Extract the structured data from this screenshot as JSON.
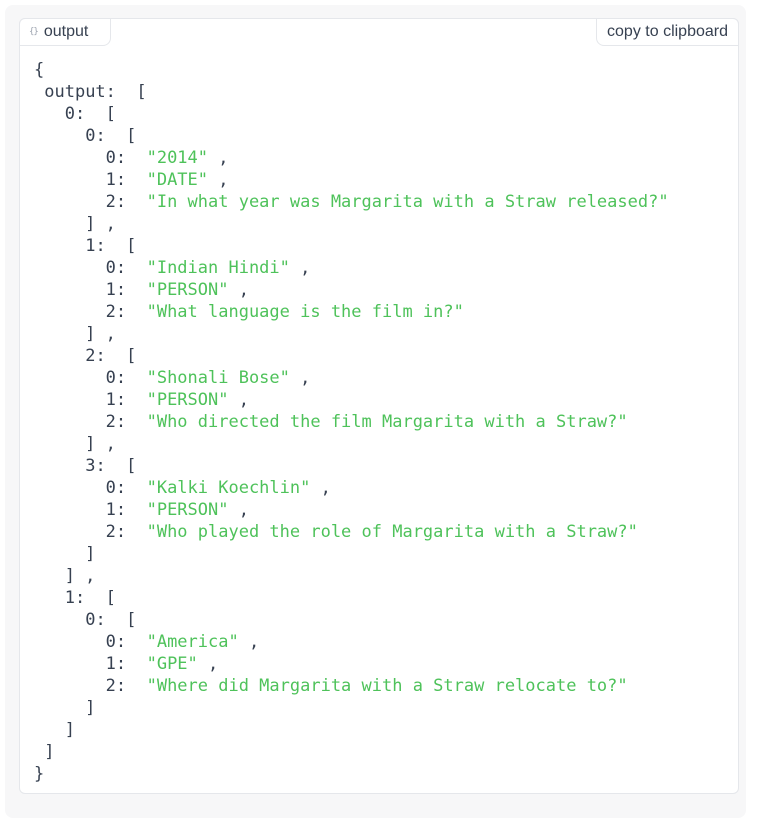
{
  "panel": {
    "label": "output",
    "label_icon": "{}",
    "copy_label": "copy to clipboard"
  },
  "json_view": {
    "root_key": "output",
    "groups": [
      {
        "index": "0",
        "items": [
          {
            "index": "0",
            "values": [
              "\"2014\"",
              "\"DATE\"",
              "\"In what year was Margarita with a Straw released?\""
            ]
          },
          {
            "index": "1",
            "values": [
              "\"Indian Hindi\"",
              "\"PERSON\"",
              "\"What language is the film in?\""
            ]
          },
          {
            "index": "2",
            "values": [
              "\"Shonali Bose\"",
              "\"PERSON\"",
              "\"Who directed the film Margarita with a Straw?\""
            ]
          },
          {
            "index": "3",
            "values": [
              "\"Kalki Koechlin\"",
              "\"PERSON\"",
              "\"Who played the role of Margarita with a Straw?\""
            ]
          }
        ]
      },
      {
        "index": "1",
        "items": [
          {
            "index": "0",
            "values": [
              "\"America\"",
              "\"GPE\"",
              "\"Where did Margarita with a Straw relocate to?\""
            ]
          }
        ]
      }
    ]
  },
  "colors": {
    "string": "#4ec25a",
    "key": "#374151",
    "border": "#e5e7eb"
  }
}
